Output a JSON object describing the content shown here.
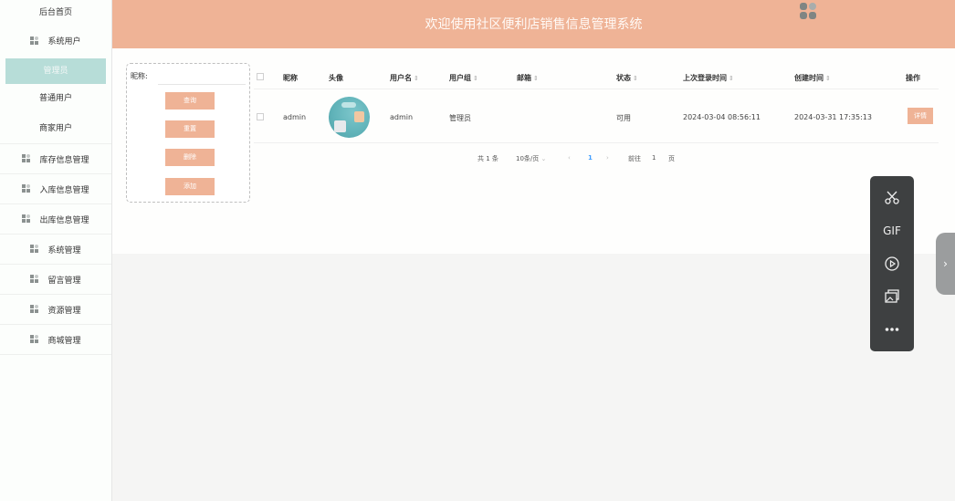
{
  "header": {
    "title": "欢迎使用社区便利店销售信息管理系统",
    "logo_icon": "app-logo-icon"
  },
  "sidebar": {
    "home": "后台首页",
    "items": [
      {
        "label": "系统用户",
        "icon": "grid-icon"
      },
      {
        "label": "库存信息管理",
        "icon": "grid-icon"
      },
      {
        "label": "入库信息管理",
        "icon": "grid-icon"
      },
      {
        "label": "出库信息管理",
        "icon": "grid-icon"
      },
      {
        "label": "系统管理",
        "icon": "grid-icon"
      },
      {
        "label": "留言管理",
        "icon": "grid-icon"
      },
      {
        "label": "资源管理",
        "icon": "grid-icon"
      },
      {
        "label": "商城管理",
        "icon": "grid-icon"
      }
    ],
    "subitems": [
      {
        "label": "管理员",
        "active": true
      },
      {
        "label": "普通用户",
        "active": false
      },
      {
        "label": "商家用户",
        "active": false
      }
    ]
  },
  "search": {
    "label": "昵称:",
    "value": "",
    "buttons": {
      "query": "查询",
      "reset": "重置",
      "delete": "删除",
      "add": "添加"
    }
  },
  "table": {
    "columns": [
      "昵称",
      "头像",
      "用户名",
      "用户组",
      "邮箱",
      "状态",
      "上次登录时间",
      "创建时间",
      "操作"
    ],
    "rows": [
      {
        "nickname": "admin",
        "username": "admin",
        "group": "管理员",
        "email": "",
        "status": "可用",
        "last_login": "2024-03-04 08:56:11",
        "created": "2024-03-31 17:35:13",
        "action": "详情"
      }
    ]
  },
  "pager": {
    "total": "共 1 条",
    "page_size": "10条/页",
    "current": "1",
    "goto_label": "前往",
    "goto_value": "1",
    "page_suffix": "页"
  },
  "toolbar": {
    "gif_label": "GIF",
    "icons": [
      "scissors-icon",
      "gif-icon",
      "record-icon",
      "screenshot-icon",
      "more-icon"
    ]
  },
  "colors": {
    "accent": "#efb396",
    "active_menu": "#b7ddd8",
    "toolbar_bg": "#3e4041"
  }
}
